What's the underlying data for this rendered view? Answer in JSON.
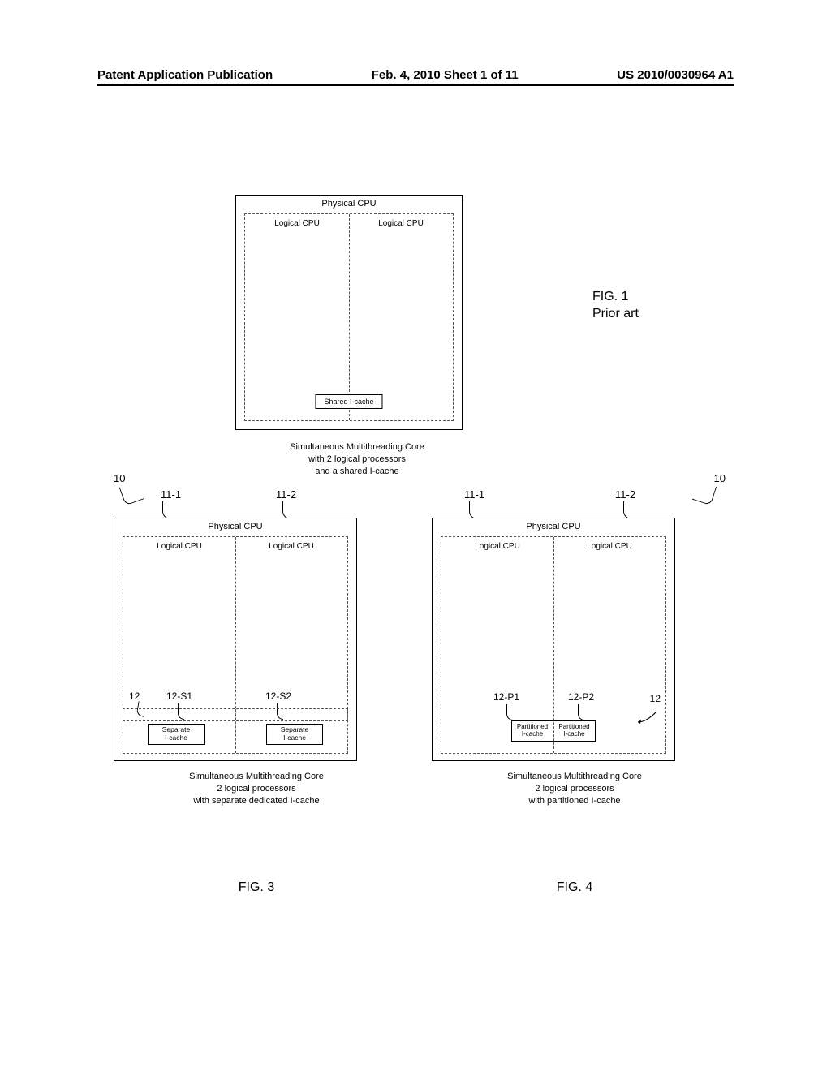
{
  "header": {
    "left": "Patent Application Publication",
    "center": "Feb. 4, 2010  Sheet 1 of 11",
    "right": "US 2010/0030964 A1"
  },
  "fig1": {
    "cpu_title": "Physical CPU",
    "lcpu": "Logical CPU",
    "shared_cache": "Shared I-cache",
    "caption_l1": "Simultaneous Multithreading Core",
    "caption_l2": "with 2 logical processors",
    "caption_l3": "and a shared I-cache",
    "side_fig": "FIG. 1",
    "side_prior": "Prior art"
  },
  "refs": {
    "r10": "10",
    "r11_1": "11-1",
    "r11_2": "11-2",
    "r12": "12",
    "r12_s1": "12-S1",
    "r12_s2": "12-S2",
    "r12_p1": "12-P1",
    "r12_p2": "12-P2"
  },
  "fig3": {
    "cpu_title": "Physical CPU",
    "lcpu": "Logical CPU",
    "sep_cache_l1": "Separate",
    "sep_cache_l2": "I-cache",
    "caption_l1": "Simultaneous Multithreading Core",
    "caption_l2": "2 logical processors",
    "caption_l3": "with separate dedicated I-cache",
    "fig_num": "FIG. 3"
  },
  "fig4": {
    "cpu_title": "Physical CPU",
    "lcpu": "Logical CPU",
    "part_cache_l1": "Partitioned",
    "part_cache_l2": "I-cache",
    "caption_l1": "Simultaneous Multithreading Core",
    "caption_l2": "2 logical processors",
    "caption_l3": "with partitioned I-cache",
    "fig_num": "FIG. 4"
  }
}
